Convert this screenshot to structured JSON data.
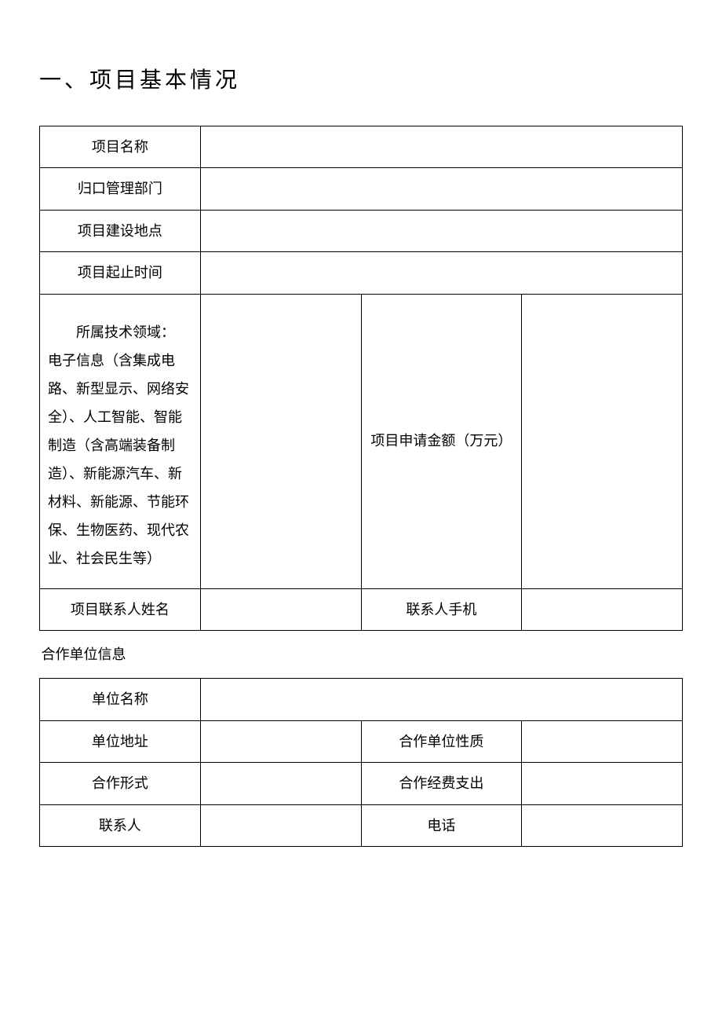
{
  "title": "一、项目基本情况",
  "rows": {
    "project_name_label": "项目名称",
    "project_name_value": "",
    "dept_label": "归口管理部门",
    "dept_value": "",
    "location_label": "项目建设地点",
    "location_value": "",
    "duration_label": "项目起止时间",
    "duration_value": "",
    "tech_domain_title": "所属技术领域：",
    "tech_domain_body": "电子信息（含集成电路、新型显示、网络安全）、人工智能、智能制造（含高端装备制造）、新能源汽车、新材料、新能源、节能环保、生物医药、现代农业、社会民生等）",
    "tech_domain_value": "",
    "amount_label": "项目申请金额（万元）",
    "amount_value": "",
    "contact_name_label": "项目联系人姓名",
    "contact_name_value": "",
    "contact_phone_label": "联系人手机",
    "contact_phone_value": "",
    "partner_section": "合作单位信息",
    "partner_name_label": "单位名称",
    "partner_name_value": "",
    "partner_addr_label": "单位地址",
    "partner_addr_value": "",
    "partner_nature_label": "合作单位性质",
    "partner_nature_value": "",
    "coop_form_label": "合作形式",
    "coop_form_value": "",
    "coop_expense_label": "合作经费支出",
    "coop_expense_value": "",
    "partner_contact_label": "联系人",
    "partner_contact_value": "",
    "partner_tel_label": "电话",
    "partner_tel_value": ""
  }
}
